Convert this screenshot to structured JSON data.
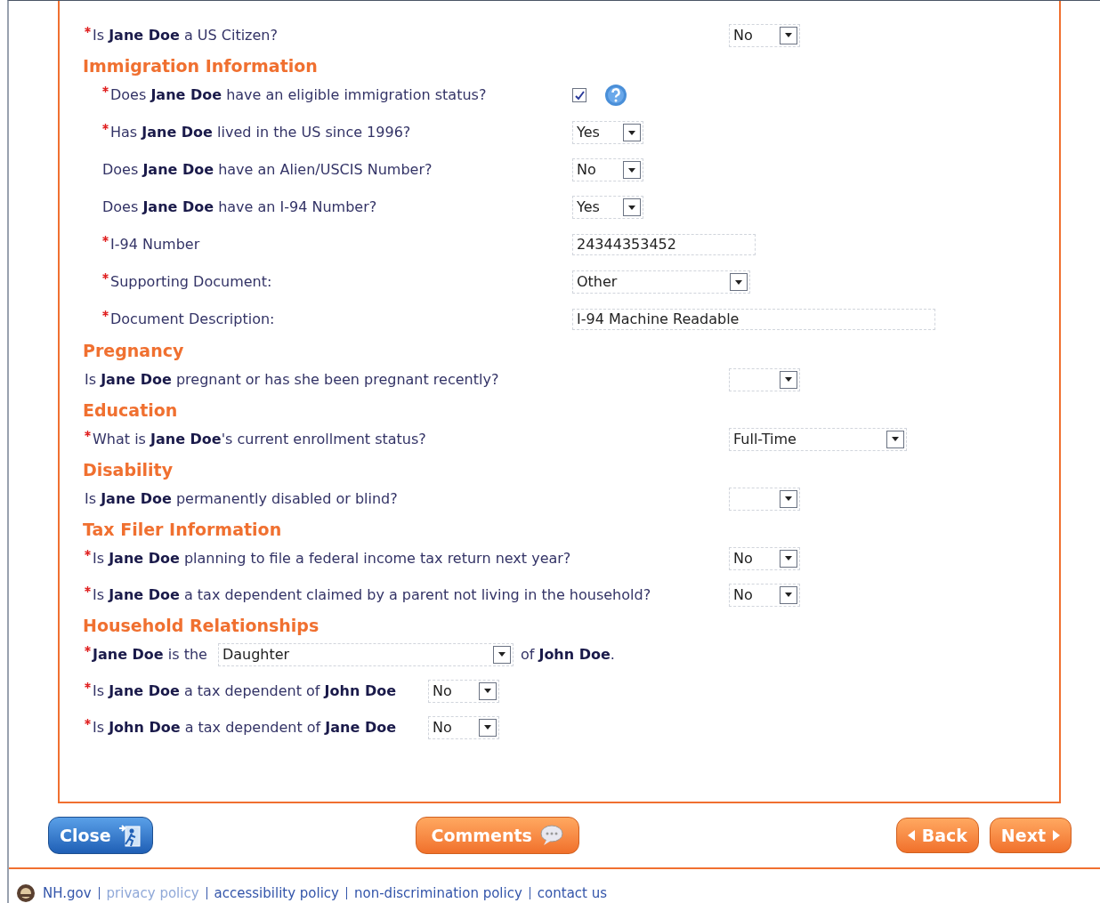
{
  "questions": [
    {
      "label": "Is **Jane Doe** a US Citizen?",
      "required": true,
      "kind": "select",
      "value": "No"
    }
  ],
  "sections": [
    {
      "title": "Immigration Information",
      "questions": [
        {
          "label": "Does **Jane Doe** have an eligible immigration status?",
          "required": true,
          "kind": "checkbox",
          "checked": true
        },
        {
          "label": "Has **Jane Doe** lived in the US since 1996?",
          "required": true,
          "kind": "select",
          "value": "Yes"
        },
        {
          "label": "Does **Jane Doe** have an Alien/USCIS Number?",
          "required": false,
          "kind": "select",
          "value": "No"
        },
        {
          "label": "Does **Jane Doe** have an I-94 Number?",
          "required": false,
          "kind": "select",
          "value": "Yes"
        },
        {
          "label": "I-94 Number",
          "required": true,
          "kind": "text",
          "value": "24344353452"
        },
        {
          "label": "Supporting Document:",
          "required": true,
          "kind": "select",
          "value": "Other"
        },
        {
          "label": "Document Description:",
          "required": true,
          "kind": "longtext",
          "value": "I-94 Machine Readable"
        }
      ]
    },
    {
      "title": "Pregnancy",
      "questions": [
        {
          "label": "Is **Jane Doe** pregnant or has she been pregnant recently?",
          "required": false,
          "kind": "select"
        }
      ]
    },
    {
      "title": "Education",
      "questions": [
        {
          "label": "What is **Jane Doe**'s current enrollment status?",
          "required": true,
          "kind": "select",
          "value": "Full-Time"
        }
      ]
    },
    {
      "title": "Disability",
      "questions": [
        {
          "label": "Is **Jane Doe** permanently disabled or blind?",
          "required": false,
          "kind": "select"
        }
      ]
    },
    {
      "title": "Tax Filer Information",
      "questions": [
        {
          "label": "Is **Jane Doe** planning to file a federal income tax return next year?",
          "required": true,
          "kind": "select",
          "value": "No"
        },
        {
          "label": "Is **Jane Doe** a tax dependent claimed by a parent not living in the household?",
          "required": true,
          "kind": "select",
          "value": "No"
        }
      ]
    },
    {
      "title": "Household Relationships",
      "questions": [
        {
          "label": "**Jane Doe** is the",
          "required": true,
          "kind": "relation",
          "value": "Daughter",
          "suffix": "of **John Doe**."
        },
        {
          "label": "Is **Jane Doe** a tax dependent of **John Doe**",
          "required": true,
          "kind": "inline",
          "value": "No"
        },
        {
          "label": "Is **John Doe** a tax dependent of **Jane Doe**",
          "required": true,
          "kind": "inline",
          "value": "No"
        }
      ]
    }
  ],
  "buttons": {
    "close": "Close",
    "comments": "Comments",
    "back": "Back",
    "next": "Next"
  },
  "footer_links": [
    "NH.gov",
    "privacy policy",
    "accessibility policy",
    "non-discrimination policy",
    "contact us"
  ]
}
